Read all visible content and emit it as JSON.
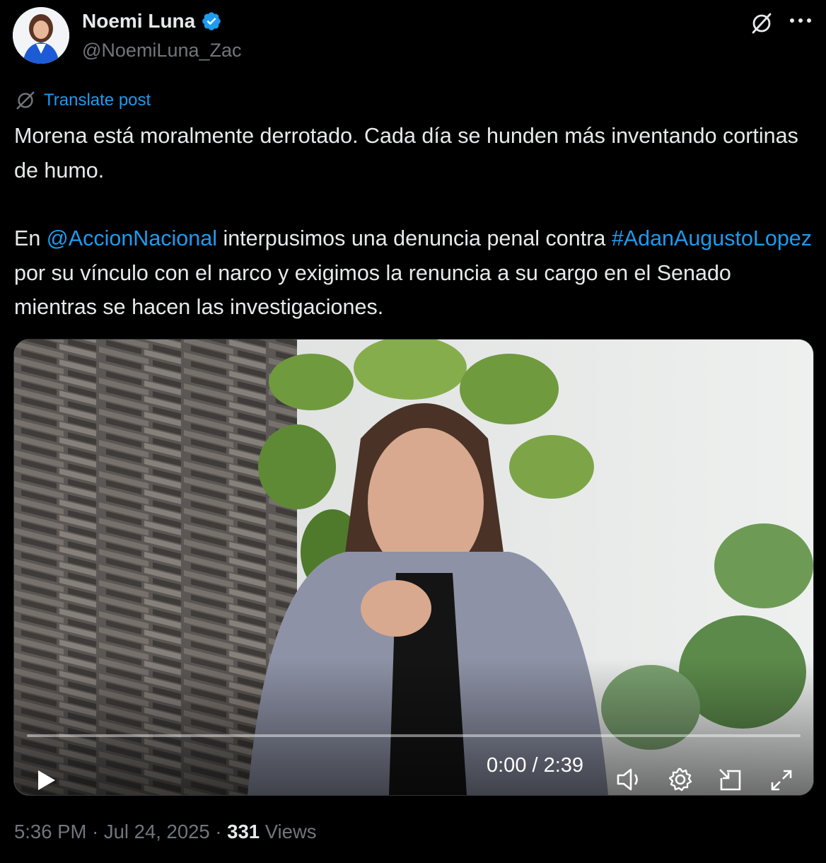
{
  "author": {
    "name": "Noemi Luna",
    "handle": "@NoemiLuna_Zac",
    "verified_color": "#1d9bf0"
  },
  "header_icons": [
    "grok-icon",
    "more-icon"
  ],
  "translate_label": "Translate post",
  "post": {
    "line1": "Morena está moralmente derrotado. Cada día se hunden más inventando cortinas de humo.",
    "p2_before": "En ",
    "mention": "@AccionNacional",
    "p2_mid": " interpusimos  una denuncia penal contra ",
    "hashtag": "#AdanAugustoLopez",
    "p2_after": " por su vínculo con el narco y exigimos la renuncia a su cargo en el Senado mientras se hacen las investigaciones."
  },
  "video": {
    "time": "0:00 / 2:39",
    "progress": 0,
    "controls": [
      "play-icon",
      "volume-icon",
      "settings-icon",
      "pip-icon",
      "fullscreen-icon"
    ]
  },
  "meta": {
    "time": "5:36 PM",
    "date": "Jul 24, 2025",
    "views_count": "331",
    "views_label": "Views"
  },
  "colors": {
    "background": "#000000",
    "text": "#e7e9ea",
    "muted": "#71767b",
    "accent": "#1d9bf0"
  }
}
